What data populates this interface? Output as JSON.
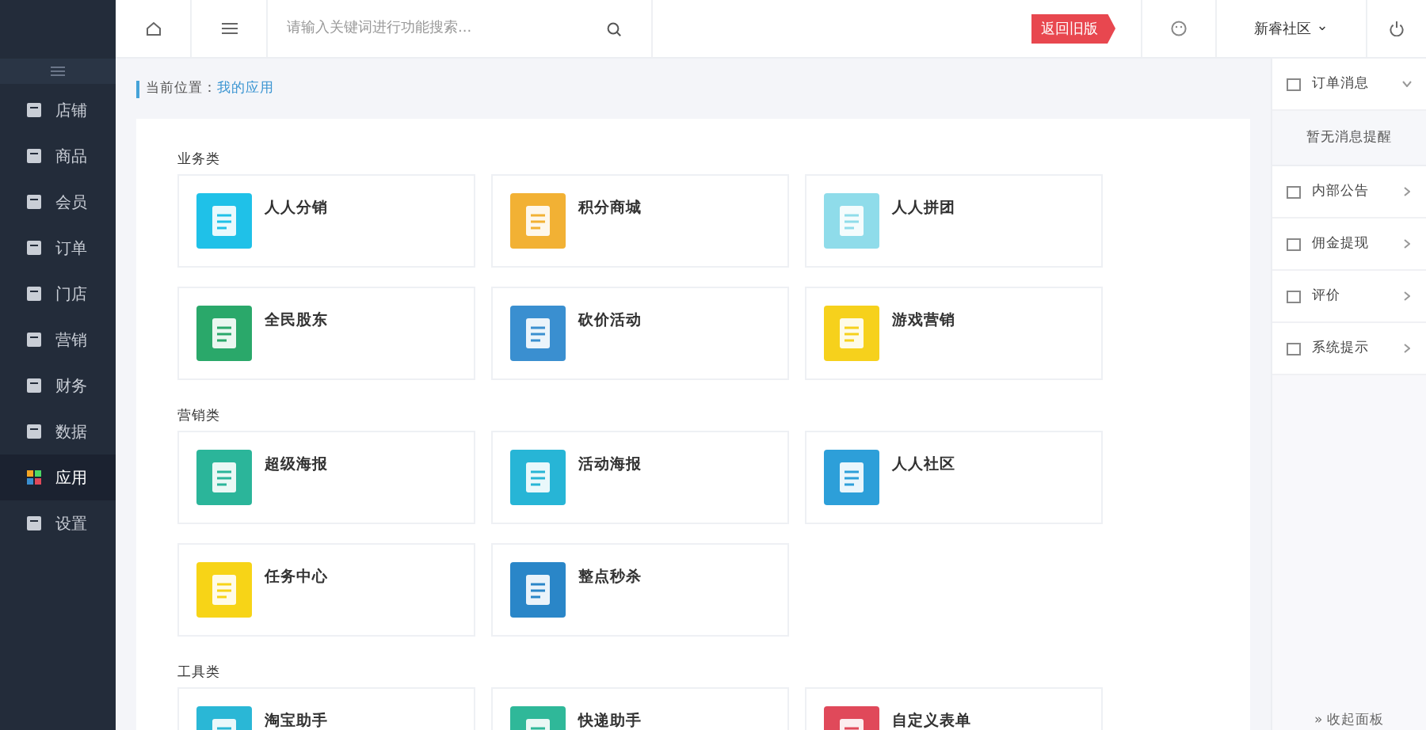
{
  "topbar": {
    "search": {
      "placeholder": "请输入关键词进行功能搜索..."
    },
    "old_version_badge": "返回旧版",
    "account": "新睿社区",
    "account_caret": "⌄"
  },
  "sidebar": {
    "items": [
      {
        "label": "店铺",
        "selected": false
      },
      {
        "label": "商品",
        "selected": false
      },
      {
        "label": "会员",
        "selected": false
      },
      {
        "label": "订单",
        "selected": false
      },
      {
        "label": "门店",
        "selected": false
      },
      {
        "label": "营销",
        "selected": false
      },
      {
        "label": "财务",
        "selected": false
      },
      {
        "label": "数据",
        "selected": false
      },
      {
        "label": "应用",
        "selected": true
      },
      {
        "label": "设置",
        "selected": false
      }
    ]
  },
  "breadcrumb": {
    "label": "当前位置：",
    "link": "我的应用"
  },
  "sections": [
    {
      "title": "业务类",
      "apps": [
        {
          "name": "人人分销",
          "color": "#1fc1e8"
        },
        {
          "name": "积分商城",
          "color": "#f2b134"
        },
        {
          "name": "人人拼团",
          "color": "#8fdcea"
        },
        {
          "name": "全民股东",
          "color": "#2aa86a"
        },
        {
          "name": "砍价活动",
          "color": "#3a8fd0"
        },
        {
          "name": "游戏营销",
          "color": "#f6d11c"
        }
      ]
    },
    {
      "title": "营销类",
      "apps": [
        {
          "name": "超级海报",
          "color": "#2bb59a"
        },
        {
          "name": "活动海报",
          "color": "#27b5d6"
        },
        {
          "name": "人人社区",
          "color": "#2d9fd9"
        },
        {
          "name": "任务中心",
          "color": "#f7d417"
        },
        {
          "name": "整点秒杀",
          "color": "#2a86c8"
        }
      ]
    },
    {
      "title": "工具类",
      "apps": [
        {
          "name": "淘宝助手",
          "color": "#2ab7d6"
        },
        {
          "name": "快递助手",
          "color": "#2fb899"
        },
        {
          "name": "自定义表单",
          "color": "#e0495a"
        }
      ]
    }
  ],
  "right_panel": {
    "items": [
      {
        "label": "订单消息",
        "expanded": true,
        "empty_text": "暂无消息提醒"
      },
      {
        "label": "内部公告",
        "expanded": false
      },
      {
        "label": "佣金提现",
        "expanded": false
      },
      {
        "label": "评价",
        "expanded": false
      },
      {
        "label": "系统提示",
        "expanded": false
      }
    ],
    "collapse_link": "» 收起面板"
  }
}
